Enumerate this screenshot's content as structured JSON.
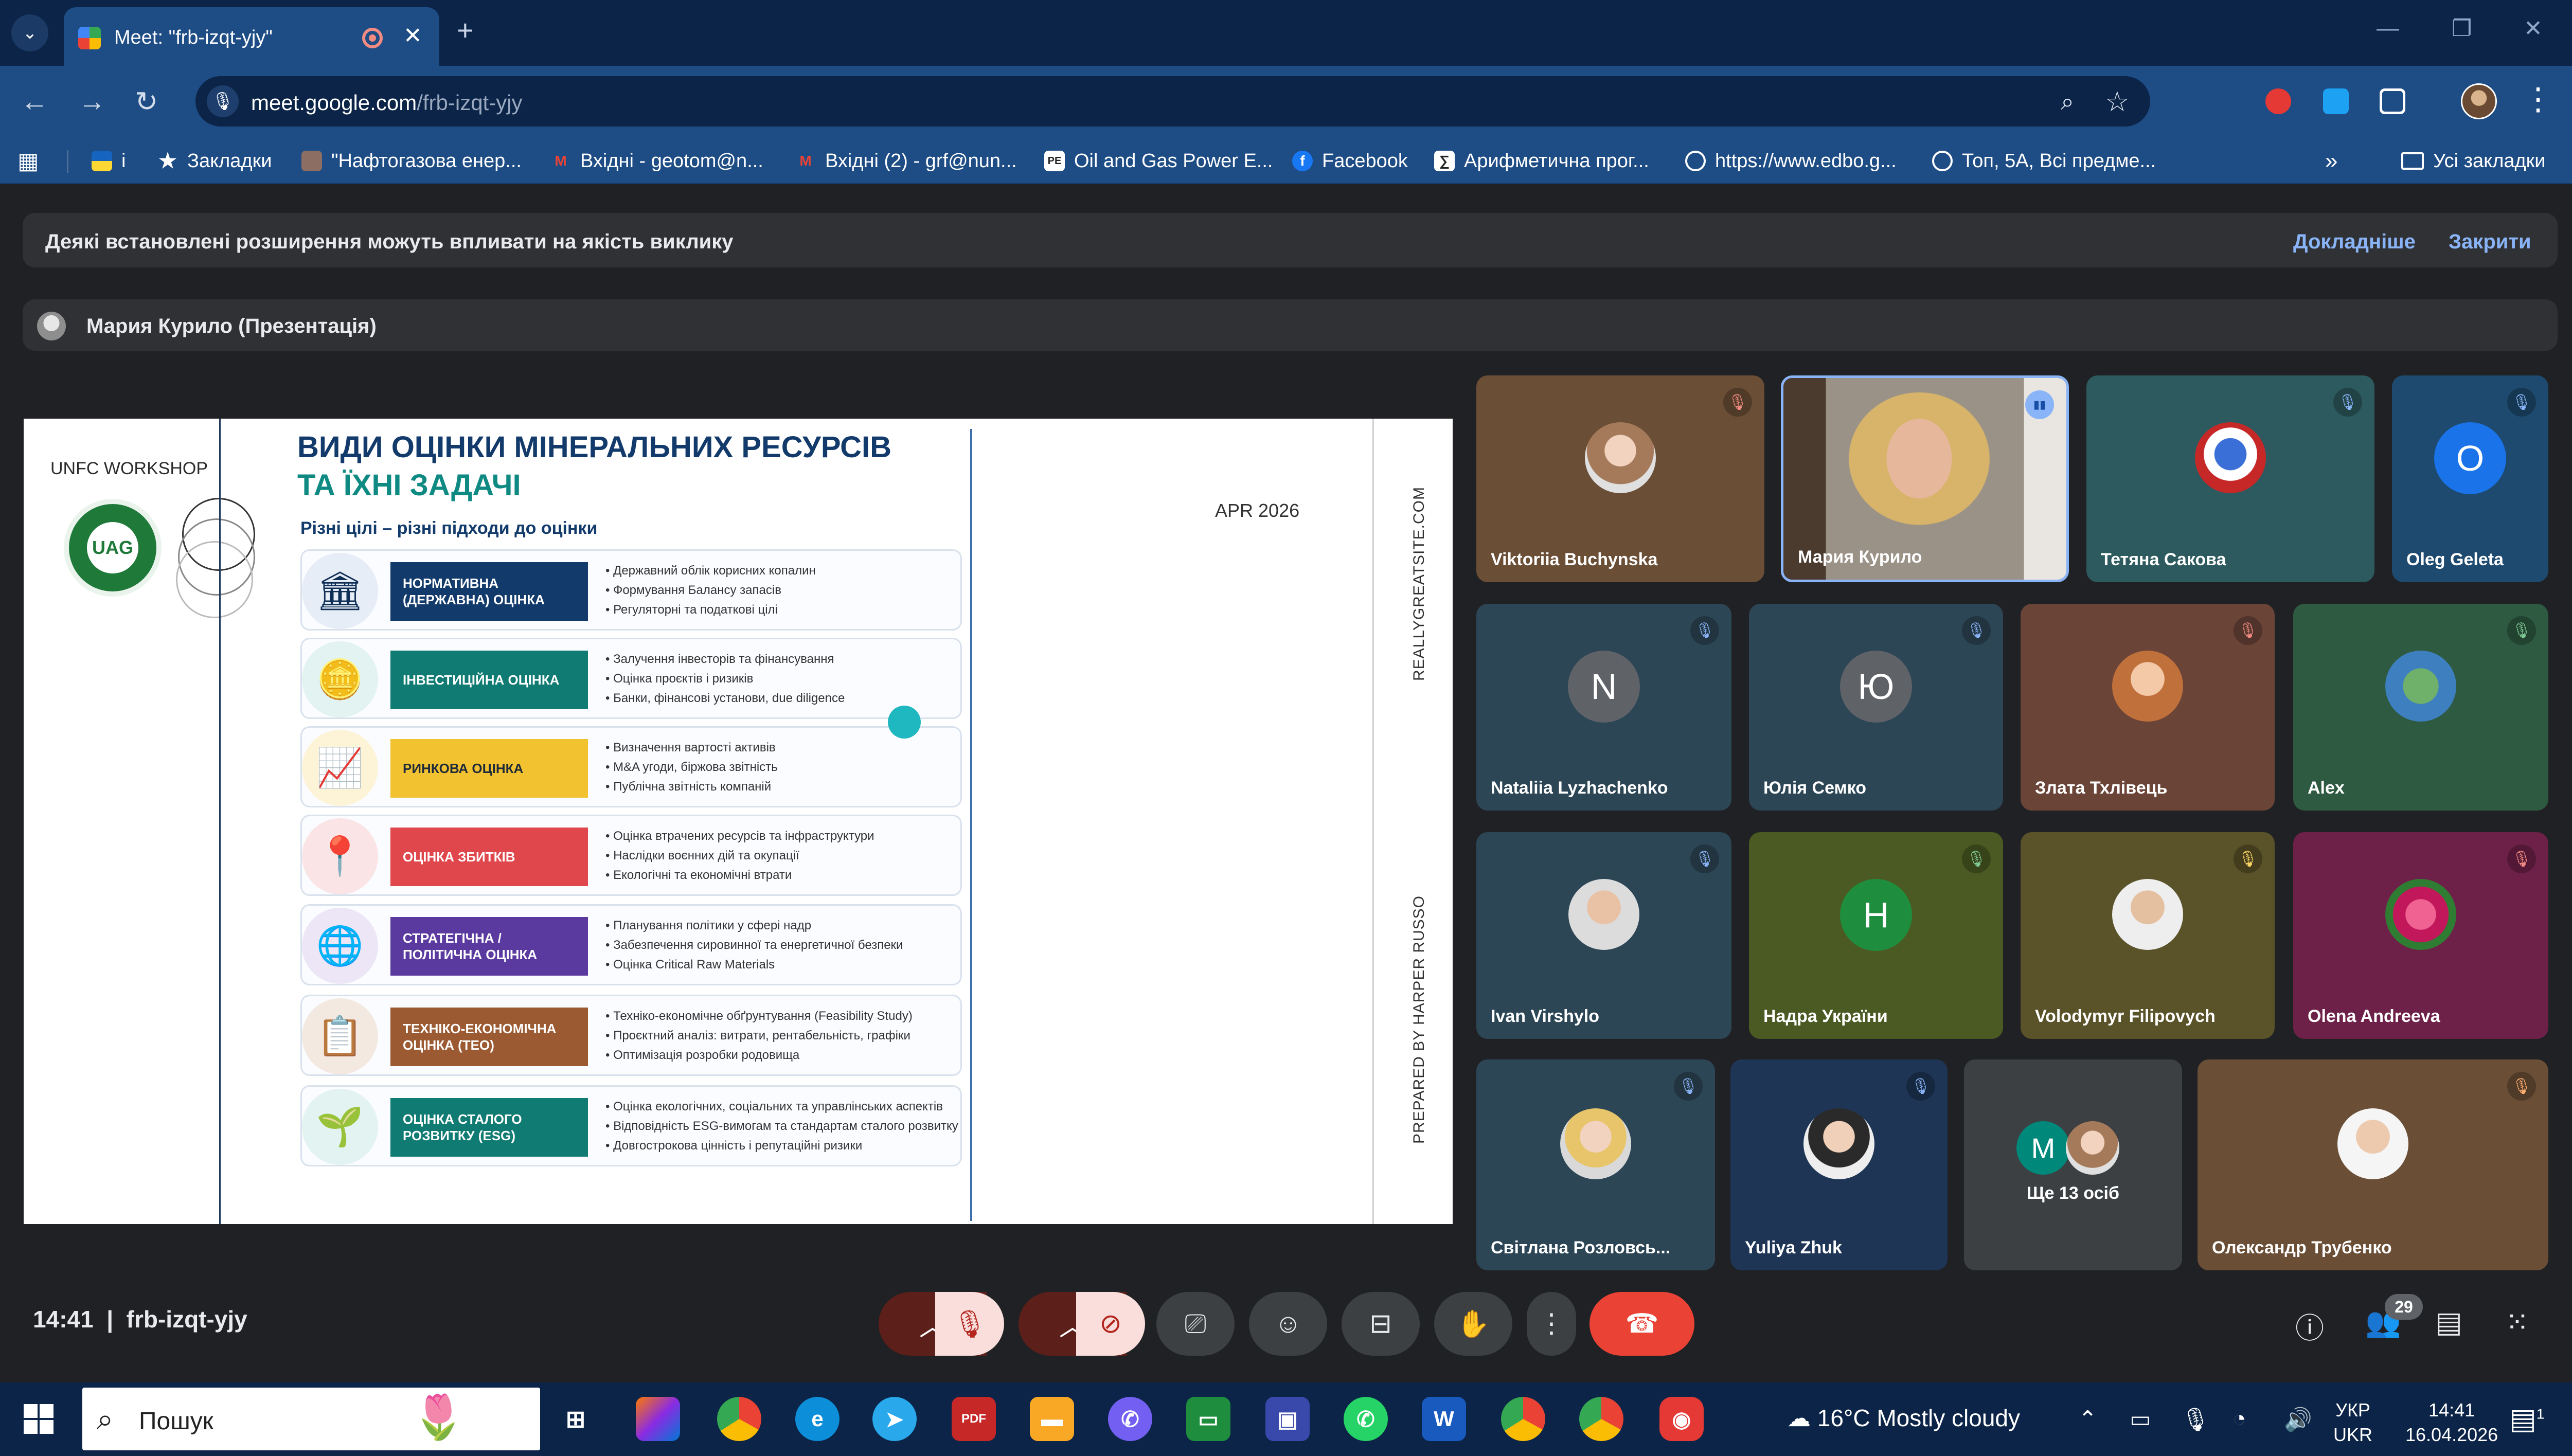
{
  "browser": {
    "tab_title": "Meet: \"frb-izqt-yjy\"",
    "url_host": "meet.google.com",
    "url_path": "/frb-izqt-yjy",
    "bookmarks": [
      {
        "label": "і",
        "icon": "ukr-flag-icon"
      },
      {
        "label": "Закладки",
        "icon": "star-icon"
      },
      {
        "label": "\"Нафтогазова енер...",
        "icon": "site-icon"
      },
      {
        "label": "Вхідні - geotom@n...",
        "icon": "gmail-icon"
      },
      {
        "label": "Вхідні (2) - grf@nun...",
        "icon": "gmail-icon"
      },
      {
        "label": "Oil and Gas Power E...",
        "icon": "pe-icon"
      },
      {
        "label": "Facebook",
        "icon": "facebook-icon"
      },
      {
        "label": "Арифметична прог...",
        "icon": "site-icon"
      },
      {
        "label": "https://www.edbo.g...",
        "icon": "globe-icon"
      },
      {
        "label": "Топ, 5А, Всі предме...",
        "icon": "globe-icon"
      }
    ],
    "all_bookmarks": "Усі закладки"
  },
  "meet": {
    "banner": {
      "message": "Деякі встановлені розширення можуть впливати на якість виклику",
      "learn_more": "Докладніше",
      "close": "Закрити"
    },
    "presenter": "Мария Курило (Презентація)",
    "slide": {
      "workshop": "UNFC WORKSHOP",
      "logo_text": "UAG",
      "title_line1": "ВИДИ ОЦІНКИ МІНЕРАЛЬНИХ РЕСУРСІВ",
      "title_line2": "ТА ЇХНІ ЗАДАЧІ",
      "subtitle": "Різні цілі – різні підходи до оцінки",
      "date": "APR 2026",
      "side_text_top": "REALLYGREATSITE.COM",
      "side_text_bottom": "PREPARED BY HARPER RUSSO",
      "cards": [
        {
          "label": "НОРМАТИВНА (ДЕРЖАВНА) ОЦІНКА",
          "color": "#123a6b",
          "icon": "bank-icon",
          "bullets": [
            "Державний облік корисних копалин",
            "Формування Балансу запасів",
            "Регуляторні та податкові цілі"
          ]
        },
        {
          "label": "ІНВЕСТИЦІЙНА ОЦІНКА",
          "color": "#0f7b72",
          "icon": "coins-icon",
          "bullets": [
            "Залучення інвесторів та фінансування",
            "Оцінка проєктів і ризиків",
            "Банки, фінансові установи, due diligence"
          ]
        },
        {
          "label": "РИНКОВА ОЦІНКА",
          "color": "#f2c230",
          "icon": "market-chart-icon",
          "bullets": [
            "Визначення вартості активів",
            "M&A угоди, біржова звітність",
            "Публічна звітність компаній"
          ]
        },
        {
          "label": "ОЦІНКА ЗБИТКІВ",
          "color": "#e0474c",
          "icon": "damage-pin-icon",
          "bullets": [
            "Оцінка втрачених ресурсів та інфраструктури",
            "Наслідки воєнних дій та окупації",
            "Екологічні та економічні втрати"
          ]
        },
        {
          "label": "СТРАТЕГІЧНА / ПОЛІТИЧНА ОЦІНКА",
          "color": "#5b3aa0",
          "icon": "globe-icon",
          "bullets": [
            "Планування політики у сфері надр",
            "Забезпечення сировинної та енергетичної безпеки",
            "Оцінка Critical Raw Materials"
          ]
        },
        {
          "label": "ТЕХНІКО-ЕКОНОМІЧНА ОЦІНКА (ТЕО)",
          "color": "#9b5a32",
          "icon": "clipboard-icon",
          "bullets": [
            "Техніко-економічне обґрунтування (Feasibility Study)",
            "Проєктний аналіз: витрати, рентабельність, графіки",
            "Оптимізація розробки родовища"
          ]
        },
        {
          "label": "ОЦІНКА СТАЛОГО РОЗВИТКУ (ESG)",
          "color": "#0f7b72",
          "icon": "plant-hand-icon",
          "bullets": [
            "Оцінка екологічних, соціальних та управлінських аспектів",
            "Відповідність ESG-вимогам та стандартам сталого розвитку",
            "Довгострокова цінність і репутаційні ризики"
          ]
        }
      ]
    },
    "participants": [
      {
        "name": "Viktoriia Buchynska",
        "bg": "#6b4e36",
        "mic": "muted-red"
      },
      {
        "name": "Мария Курило",
        "bg": "#5a4a3e",
        "mic": "speaking"
      },
      {
        "name": "Тетяна Сакова",
        "bg": "#2d5a5e",
        "mic": "muted"
      },
      {
        "name": "Oleg Geleta",
        "bg": "#1d4a6e",
        "mic": "muted",
        "letter": "O",
        "letter_bg": "#1a73e8"
      },
      {
        "name": "Nataliia Lyzhachenko",
        "bg": "#2c4656",
        "mic": "muted",
        "letter": "N",
        "letter_bg": "#5f6368"
      },
      {
        "name": "Юлія Семко",
        "bg": "#2c4656",
        "mic": "muted",
        "letter": "Ю",
        "letter_bg": "#5f6368"
      },
      {
        "name": "Злата Тхлівець",
        "bg": "#6b4438",
        "mic": "muted-red"
      },
      {
        "name": "Alex",
        "bg": "#2d5a40",
        "mic": "muted-green"
      },
      {
        "name": "Ivan Virshylo",
        "bg": "#2c4656",
        "mic": "muted"
      },
      {
        "name": "Надра України",
        "bg": "#4a5a22",
        "mic": "muted-green",
        "letter": "H",
        "letter_bg": "#1e8e3e"
      },
      {
        "name": "Volodymyr Filipovych",
        "bg": "#5a5228",
        "mic": "muted-yellow"
      },
      {
        "name": "Olena Andreeva",
        "bg": "#6e2148",
        "mic": "muted-red"
      },
      {
        "name": "Світлана Розловсь...",
        "bg": "#2c4656",
        "mic": "muted"
      },
      {
        "name": "Yuliya Zhuk",
        "bg": "#1e3556",
        "mic": "muted"
      },
      {
        "name": "Ще 13 осіб",
        "bg": "#3c4043",
        "mic": "",
        "letter": "M",
        "letter_bg": "#00897b"
      },
      {
        "name": "Олександр Трубенко",
        "bg": "#6b4e36",
        "mic": "muted-orange"
      }
    ],
    "meeting_time": "14:41",
    "meeting_code": "frb-izqt-yjy",
    "people_count": "29"
  },
  "taskbar": {
    "search_placeholder": "Пошук",
    "weather": "16°C  Mostly cloudy",
    "lang_line1": "УКР",
    "lang_line2": "UKR",
    "time": "14:41",
    "date": "16.04.2026",
    "notif_count": "1"
  }
}
